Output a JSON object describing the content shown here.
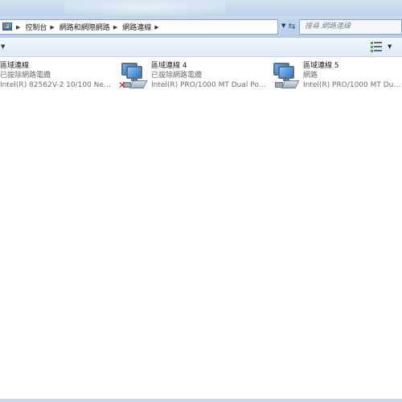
{
  "breadcrumb": {
    "items": [
      "控制台",
      "網路和網際網路",
      "網路連線"
    ]
  },
  "search": {
    "placeholder": "搜尋 網路連線"
  },
  "connections": [
    {
      "name": "區域連線",
      "status": "已拔除網路電纜",
      "device": "Intel(R) 82562V-2 10/100 Netw..."
    },
    {
      "name": "區域連線 4",
      "status": "已拔除網路電纜",
      "device": "Intel(R) PRO/1000 MT Dual Port..."
    },
    {
      "name": "區域連線 5",
      "status": "網路",
      "device": "Intel(R) PRO/1000 MT Dual Pa..."
    }
  ],
  "icons": {
    "address": "control-panel-icon",
    "refresh": "refresh-icon",
    "adapter": "network-adapter-icon",
    "disconnected": "red-x-icon",
    "view": "change-view-icon"
  },
  "colors": {
    "chrome": "#bcd2ea",
    "commandbar": "#e6eef8",
    "status_text": "#6d6d6d",
    "error": "#d22020"
  }
}
